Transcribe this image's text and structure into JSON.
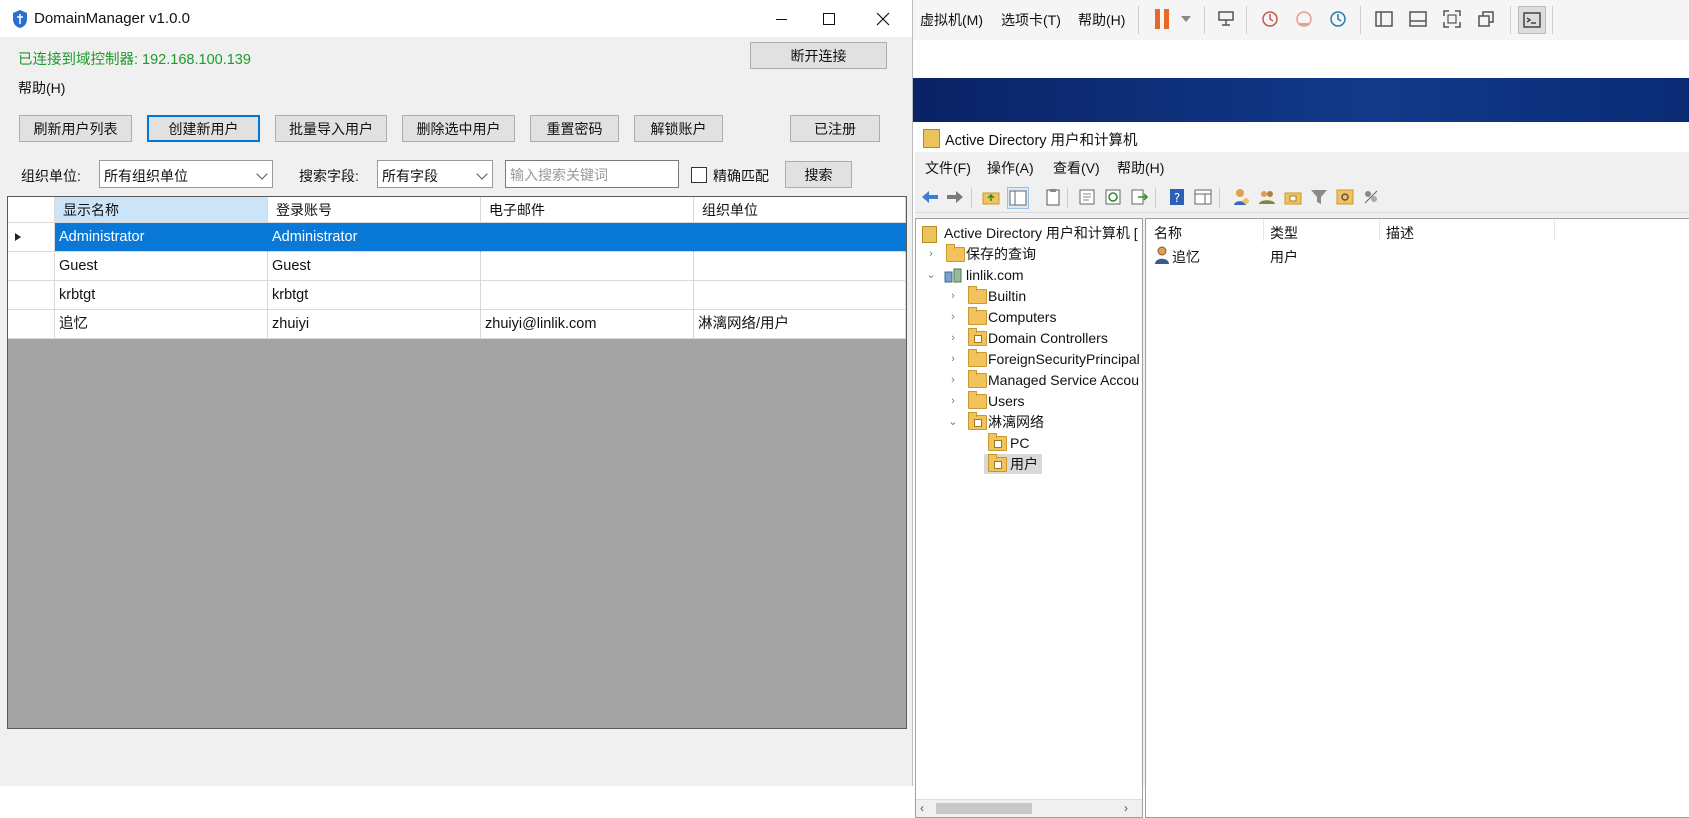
{
  "vmware": {
    "menus": [
      "虚拟机(M)",
      "选项卡(T)",
      "帮助(H)"
    ]
  },
  "ad_window": {
    "title": "Active Directory 用户和计算机",
    "menus": [
      "文件(F)",
      "操作(A)",
      "查看(V)",
      "帮助(H)"
    ],
    "tree": {
      "root": "Active Directory 用户和计算机 [",
      "saved_queries": "保存的查询",
      "domain": "linlik.com",
      "containers": [
        "Builtin",
        "Computers",
        "Domain Controllers",
        "ForeignSecurityPrincipal",
        "Managed Service Accou",
        "Users"
      ],
      "custom_ou": "淋漓网络",
      "sub_ous": [
        "PC",
        "用户"
      ]
    },
    "list": {
      "columns": [
        "名称",
        "类型",
        "描述"
      ],
      "rows": [
        {
          "name": "追忆",
          "type": "用户",
          "desc": ""
        }
      ]
    }
  },
  "dm_window": {
    "title": "DomainManager v1.0.0",
    "status": "已连接到域控制器: 192.168.100.139",
    "disconnect_label": "断开连接",
    "menu_help": "帮助(H)",
    "toolbar": {
      "refresh": "刷新用户列表",
      "create": "创建新用户",
      "batch_import": "批量导入用户",
      "delete": "删除选中用户",
      "reset_password": "重置密码",
      "unlock": "解锁账户",
      "registered": "已注册"
    },
    "filters": {
      "ou_label": "组织单位:",
      "ou_value": "所有组织单位",
      "field_label": "搜索字段:",
      "field_value": "所有字段",
      "search_placeholder": "输入搜索关键词",
      "exact_match": "精确匹配",
      "search_button": "搜索"
    },
    "grid": {
      "columns": [
        "显示名称",
        "登录账号",
        "电子邮件",
        "组织单位"
      ],
      "rows": [
        {
          "display": "Administrator",
          "login": "Administrator",
          "email": "",
          "ou": ""
        },
        {
          "display": "Guest",
          "login": "Guest",
          "email": "",
          "ou": ""
        },
        {
          "display": "krbtgt",
          "login": "krbtgt",
          "email": "",
          "ou": ""
        },
        {
          "display": "追忆",
          "login": "zhuiyi",
          "email": "zhuiyi@linlik.com",
          "ou": "淋漓网络/用户"
        }
      ],
      "selected_row": 0
    },
    "colors": {
      "accent": "#0078d7",
      "status_green": "#1f9a2a",
      "selection": "#0a78d6"
    }
  }
}
